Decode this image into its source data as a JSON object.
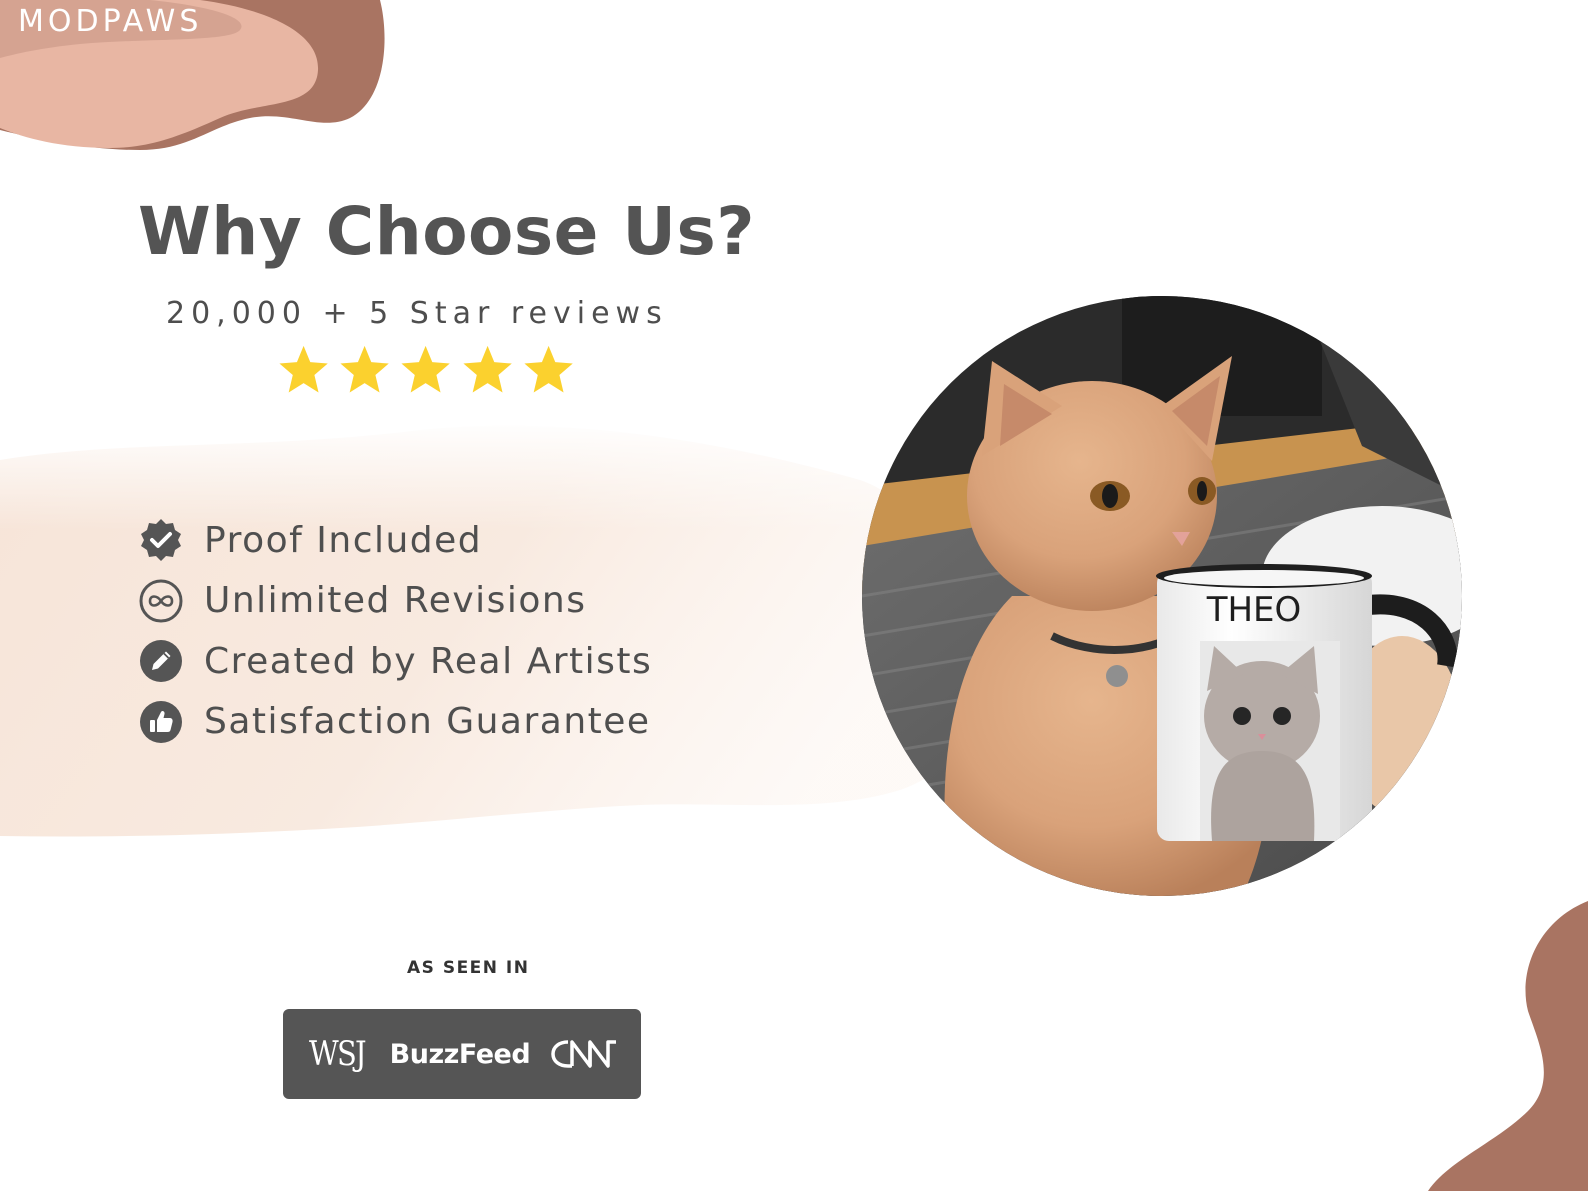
{
  "brand": {
    "name": "MODPAWS"
  },
  "hero": {
    "title": "Why Choose Us?",
    "subtitle": "20,000 + 5 Star reviews",
    "rating": {
      "stars": 5,
      "max": 5,
      "color": "#FBD12E"
    }
  },
  "features": [
    {
      "label": "Proof Included",
      "icon": "check-badge-icon"
    },
    {
      "label": "Unlimited Revisions",
      "icon": "infinity-icon"
    },
    {
      "label": "Created by Real Artists",
      "icon": "pencil-icon"
    },
    {
      "label": "Satisfaction Guarantee",
      "icon": "thumbs-up-icon"
    }
  ],
  "photo": {
    "mug_text": "THEO"
  },
  "press": {
    "label": "AS SEEN IN",
    "logos": {
      "wsj": "WSJ",
      "buzzfeed": "BuzzFeed",
      "cnn": "CNN"
    }
  },
  "colors": {
    "blob_dark": "#A97462",
    "blob_light": "#E8B6A3",
    "text": "#555555",
    "press_bg": "#555555"
  }
}
